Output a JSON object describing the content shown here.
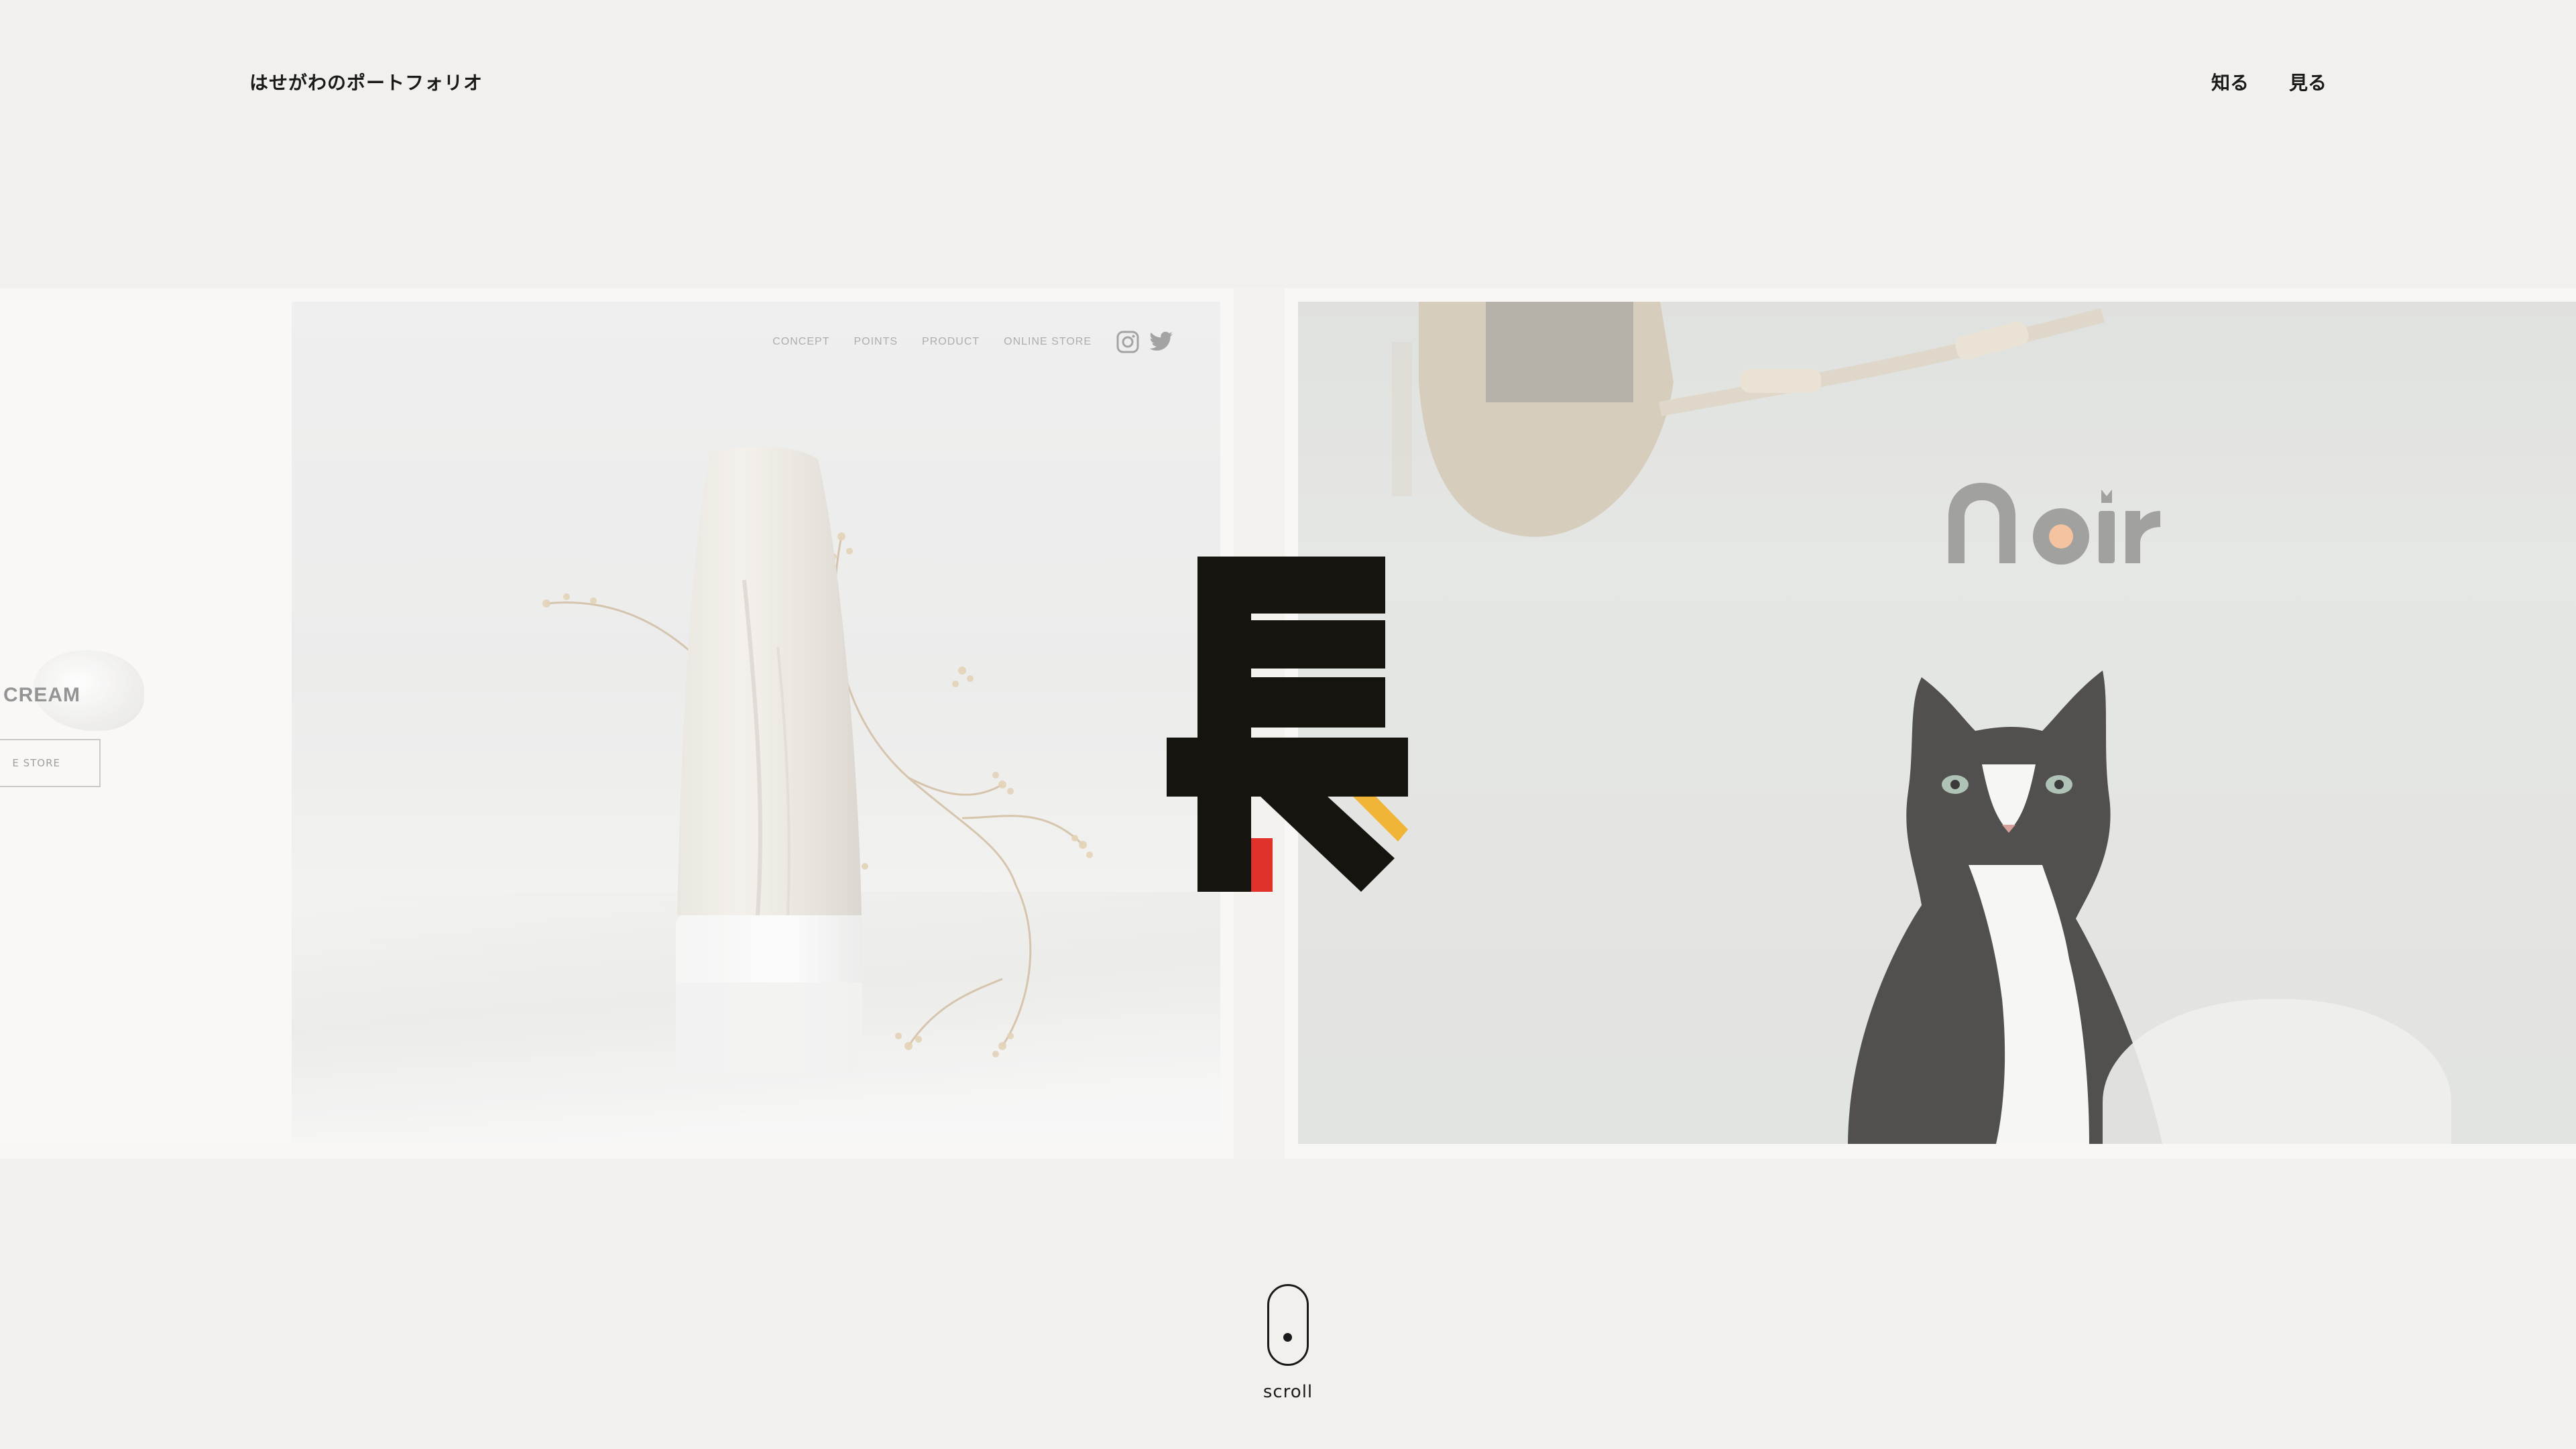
{
  "header": {
    "site_title": "はせがわのポートフォリオ",
    "nav": [
      {
        "label": "知る"
      },
      {
        "label": "見る"
      }
    ]
  },
  "slides": {
    "previous": {
      "title": "CREAM",
      "button_label": "E STORE"
    },
    "product_site": {
      "nav": [
        "CONCEPT",
        "POINTS",
        "PRODUCT",
        "ONLINE STORE"
      ],
      "icons": [
        "instagram-icon",
        "twitter-icon"
      ]
    },
    "cat_site": {
      "logo_text": "Noir",
      "logo_accent_color": "#f3b68a"
    }
  },
  "center_logo": {
    "icon": "長-mark",
    "colors": {
      "main": "#16140f",
      "red": "#e0322b",
      "yellow": "#f0b437"
    }
  },
  "scroll": {
    "label": "scroll"
  }
}
